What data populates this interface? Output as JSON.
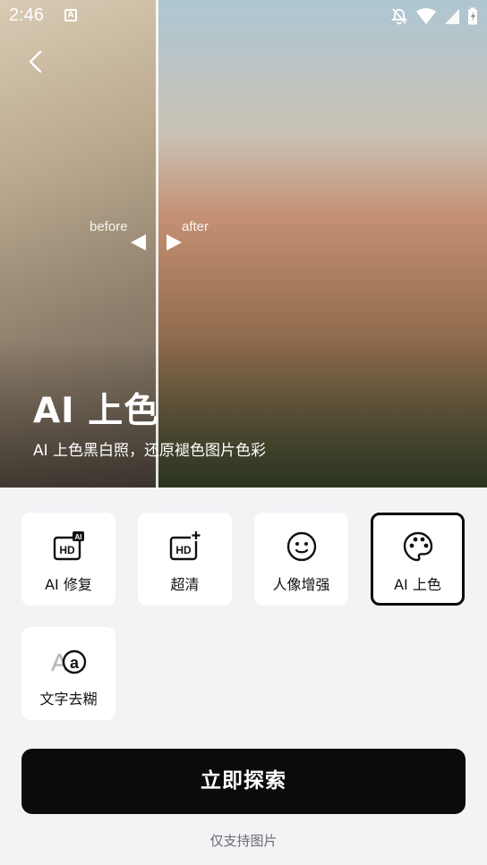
{
  "status_bar": {
    "time": "2:46",
    "notification_badge": "A"
  },
  "hero": {
    "before_label": "before",
    "after_label": "after",
    "title": "AI 上色",
    "subtitle": "AI 上色黑白照，还原褪色图片色彩"
  },
  "tools": [
    {
      "label": "AI 修复",
      "icon": "hd-ai-icon",
      "selected": false
    },
    {
      "label": "超清",
      "icon": "hd-plus-icon",
      "selected": false
    },
    {
      "label": "人像增强",
      "icon": "face-icon",
      "selected": false
    },
    {
      "label": "AI 上色",
      "icon": "palette-icon",
      "selected": true
    },
    {
      "label": "文字去糊",
      "icon": "text-deblur-icon",
      "selected": false
    }
  ],
  "cta": {
    "label": "立即探索"
  },
  "footnote": "仅支持图片",
  "colors": {
    "cta_bg": "#0b0b0c",
    "page_bg": "#f3f3f6",
    "card_bg": "#ffffff"
  }
}
